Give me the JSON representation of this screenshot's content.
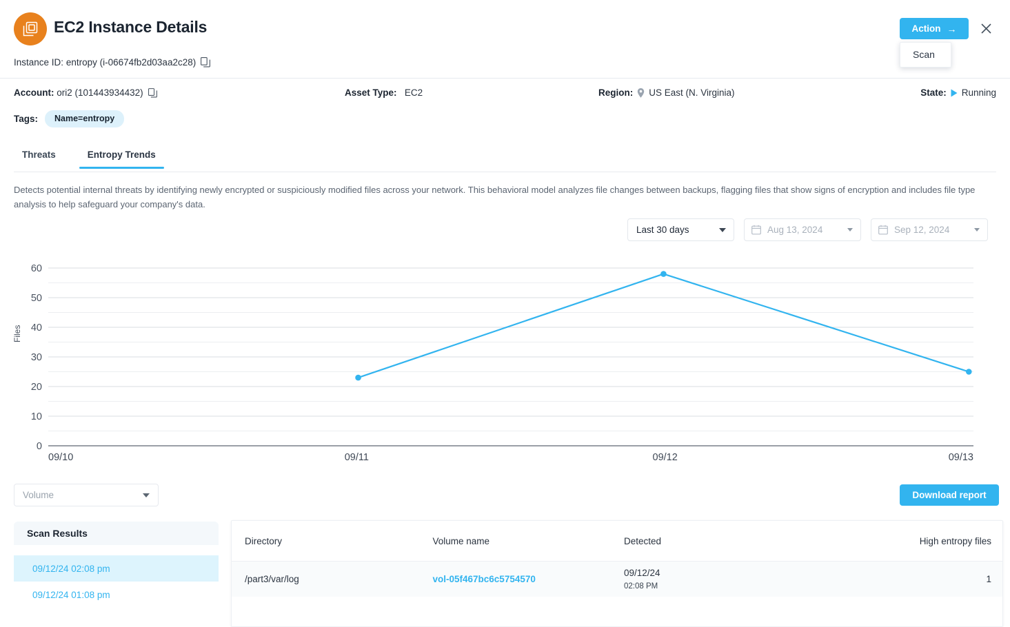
{
  "header": {
    "title": "EC2 Instance Details",
    "app_icon": "ec2-chip-icon",
    "instance_id_label": "Instance ID:",
    "instance_name": "entropy",
    "instance_id": "(i-06674fb2d03aa2c28)",
    "copy_icon": "copy-icon",
    "action_button": "Action",
    "action_arrow": "→",
    "close_icon": "×",
    "dropdown": {
      "items": [
        "Scan"
      ]
    }
  },
  "meta": {
    "account_label": "Account:",
    "account_value": "ori2 (101443934432)",
    "asset_type_label": "Asset Type:",
    "asset_type_value": "EC2",
    "region_label": "Region:",
    "region_value": "US East (N. Virginia)",
    "state_label": "State:",
    "state_value": "Running",
    "tags_label": "Tags:",
    "tags": [
      "Name=entropy"
    ]
  },
  "tabs": [
    {
      "label": "Threats",
      "active": false
    },
    {
      "label": "Entropy Trends",
      "active": true
    }
  ],
  "description": "Detects potential internal threats by identifying newly encrypted or suspiciously modified files across your network. This behavioral model analyzes file changes between backups, flagging files that show signs of encryption and includes file type analysis to help safeguard your company's data.",
  "filters": {
    "range_value": "Last 30 days",
    "from_date": "Aug 13, 2024",
    "to_date": "Sep 12, 2024",
    "calendar_icon": "calendar-icon"
  },
  "chart_data": {
    "type": "line",
    "title": "",
    "xlabel": "",
    "ylabel": "Files",
    "ylim": [
      0,
      60
    ],
    "yticks": [
      0,
      10,
      20,
      30,
      40,
      50,
      60
    ],
    "yticks_minor": [
      5,
      15,
      25,
      35,
      45,
      55
    ],
    "xticks": [
      "09/10",
      "09/11",
      "09/12",
      "09/13"
    ],
    "grid": true,
    "legend": "none",
    "series": [
      {
        "name": "Files",
        "color": "#32b4ef",
        "points": [
          {
            "x": "09/11 00:00",
            "x_frac": 0.335,
            "y": 23
          },
          {
            "x": "09/12 00:00",
            "x_frac": 0.665,
            "y": 58
          },
          {
            "x": "09/13 00:00",
            "x_frac": 0.995,
            "y": 25
          }
        ]
      }
    ]
  },
  "toolbar": {
    "volume_placeholder": "Volume",
    "download_label": "Download report"
  },
  "scan_results": {
    "title": "Scan Results",
    "items": [
      {
        "label": "09/12/24 02:08 pm",
        "active": true
      },
      {
        "label": "09/12/24 01:08 pm",
        "active": false
      }
    ]
  },
  "table": {
    "columns": [
      "Directory",
      "Volume name",
      "Detected",
      "High entropy files"
    ],
    "rows": [
      {
        "directory": "/part3/var/log",
        "volume_name": "vol-05f467bc6c5754570",
        "detected_date": "09/12/24",
        "detected_time": "02:08 PM",
        "high_entropy_files": "1"
      }
    ]
  },
  "colors": {
    "accent": "#32b4ef",
    "brand_orange": "#e8811d",
    "tag_bg": "#ddf1fb",
    "row_bg": "#f9fbfc"
  }
}
